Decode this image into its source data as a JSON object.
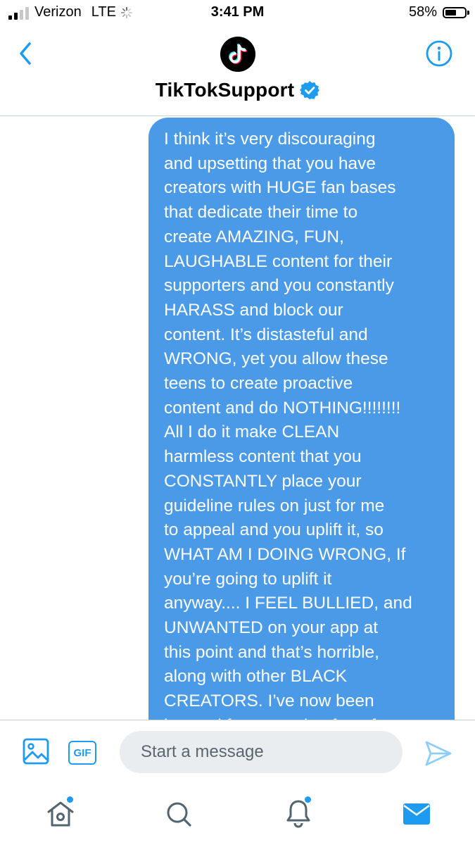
{
  "status_bar": {
    "carrier": "Verizon",
    "network": "LTE",
    "time": "3:41 PM",
    "battery_percent": "58%",
    "battery_level": 0.58,
    "signal_bars": 2
  },
  "header": {
    "contact_name": "TikTokSupport",
    "verified": true,
    "avatar_icon": "tiktok-logo-icon",
    "back_icon": "chevron-left-icon",
    "info_icon": "info-icon"
  },
  "messages": [
    {
      "from": "me",
      "text": "I think it’s very discouraging and upsetting that you have creators with HUGE fan bases that dedicate their time to create AMAZING, FUN, LAUGHABLE content for their supporters and you constantly HARASS and block our content. It’s distasteful and WRONG, yet you allow these teens to create proactive content and do NOTHING!!!!!!!! All I do it make CLEAN harmless content that you CONSTANTLY place your guideline rules on just for me to appeal and you uplift it, so WHAT AM I DOING WRONG, If you’re going to uplift it anyway.... I FEEL BULLIED, and UNWANTED on your app at this point and that’s horrible, along with other BLACK CREATORS. I’ve now been banned from creating for a few",
      "lines": [
        "I think it’s very discouraging",
        "and upsetting that you have",
        "creators with HUGE fan bases",
        "that dedicate their time to",
        "create AMAZING, FUN,",
        "LAUGHABLE content for their",
        "supporters and you constantly",
        "HARASS and block our",
        "content. It’s distasteful and",
        "WRONG, yet you allow these",
        "teens to create proactive",
        "content and do NOTHING!!!!!!!!",
        "All I do it make CLEAN",
        "harmless content that you",
        "CONSTANTLY place your",
        "guideline rules on just for me",
        "to appeal and you uplift it, so",
        "WHAT AM I DOING WRONG, If",
        "you’re going to uplift it",
        "anyway.... I FEEL BULLIED, and",
        "UNWANTED on your app at",
        "this point and that’s horrible,",
        "along with other BLACK",
        "CREATORS. I’ve now been",
        "banned from creating for a few"
      ],
      "bubble_color": "#4a9ae8"
    }
  ],
  "composer": {
    "placeholder": "Start a message",
    "image_icon": "image-icon",
    "gif_label": "GIF",
    "send_icon": "send-icon"
  },
  "tab_bar": {
    "tabs": [
      {
        "icon": "home-icon",
        "has_dot": true
      },
      {
        "icon": "search-icon",
        "has_dot": false
      },
      {
        "icon": "bell-icon",
        "has_dot": true
      },
      {
        "icon": "mail-icon",
        "has_dot": false,
        "active": true
      }
    ]
  },
  "colors": {
    "accent": "#1d9bf0",
    "bubble": "#4a9ae8",
    "input_bg": "#eaedf0",
    "divider": "#c4cfd6"
  }
}
